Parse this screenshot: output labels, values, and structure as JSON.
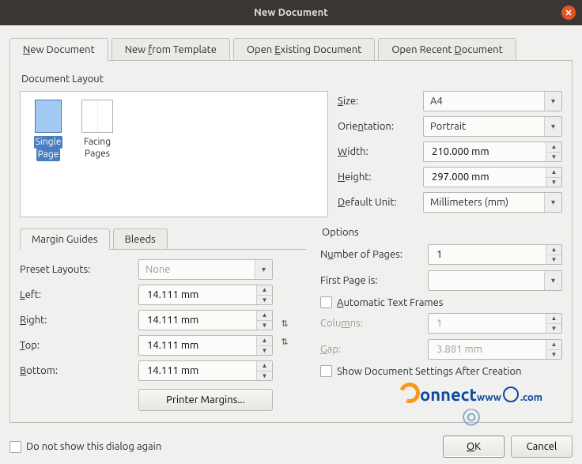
{
  "window": {
    "title": "New Document"
  },
  "tabs": {
    "new_document": "New Document",
    "new_from_template": "New from Template",
    "open_existing": "Open Existing Document",
    "open_recent": "Open Recent Document"
  },
  "layout_section": {
    "title": "Document Layout",
    "single_page_l1": "Single",
    "single_page_l2": "Page",
    "facing_l1": "Facing",
    "facing_l2": "Pages",
    "size_label": "Size:",
    "size_value": "A4",
    "orientation_label": "Orientation:",
    "orientation_value": "Portrait",
    "width_label": "Width:",
    "width_value": "210.000 mm",
    "height_label": "Height:",
    "height_value": "297.000 mm",
    "unit_label": "Default Unit:",
    "unit_value": "Millimeters (mm)"
  },
  "margins": {
    "tab_margin": "Margin Guides",
    "tab_bleeds": "Bleeds",
    "preset_label": "Preset Layouts:",
    "preset_value": "None",
    "left_label": "Left:",
    "left_value": "14.111 mm",
    "right_label": "Right:",
    "right_value": "14.111 mm",
    "top_label": "Top:",
    "top_value": "14.111 mm",
    "bottom_label": "Bottom:",
    "bottom_value": "14.111 mm",
    "printer_margins": "Printer Margins..."
  },
  "options": {
    "title": "Options",
    "num_pages_label": "Number of Pages:",
    "num_pages_value": "1",
    "first_page_label": "First Page is:",
    "first_page_value": "",
    "auto_frames": "Automatic Text Frames",
    "columns_label": "Columns:",
    "columns_value": "1",
    "gap_label": "Gap:",
    "gap_value": "3.881 mm",
    "show_settings": "Show Document Settings After Creation"
  },
  "footer": {
    "dont_show": "Do not show this dialog again",
    "ok": "OK",
    "cancel": "Cancel"
  },
  "watermark": {
    "text": "onnect",
    "suffix": ".com",
    "www": "www"
  }
}
